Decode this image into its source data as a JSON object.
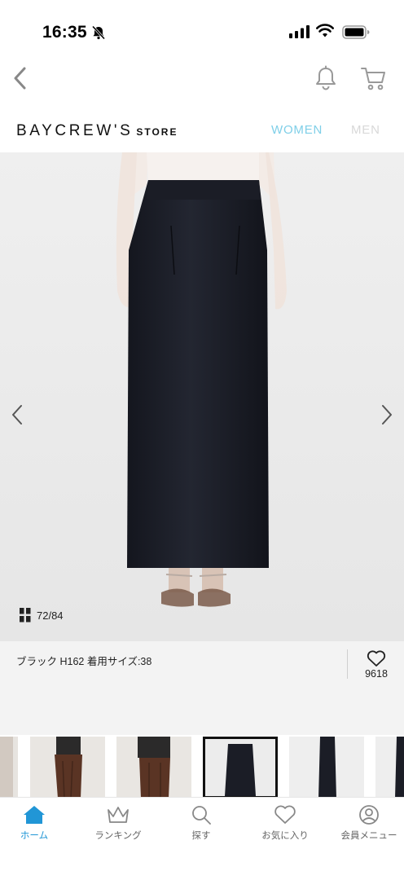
{
  "status_bar": {
    "time": "16:35"
  },
  "brand": {
    "name": "BAYCREW'S",
    "suffix": "STORE"
  },
  "gender_tabs": {
    "women": "WOMEN",
    "men": "MEN"
  },
  "gallery": {
    "counter": "72/84"
  },
  "product": {
    "caption": "ブラック H162 着用サイズ:38",
    "favorite_count": "9618"
  },
  "tab_bar": {
    "items": [
      {
        "label": "ホーム",
        "icon": "home-icon",
        "active": true
      },
      {
        "label": "ランキング",
        "icon": "crown-icon",
        "active": false
      },
      {
        "label": "探す",
        "icon": "search-icon",
        "active": false
      },
      {
        "label": "お気に入り",
        "icon": "heart-icon",
        "active": false
      },
      {
        "label": "会員メニュー",
        "icon": "user-icon",
        "active": false
      }
    ]
  },
  "colors": {
    "accent": "#2196d6",
    "women_tab": "#7fcfe8",
    "men_tab": "#d8d8d8"
  }
}
